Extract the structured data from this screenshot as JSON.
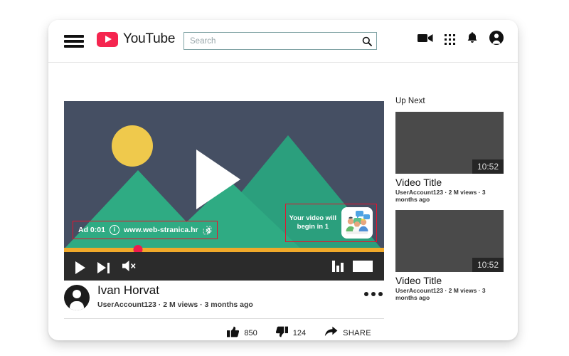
{
  "header": {
    "menu_icon": "hamburger-menu-icon",
    "brand": "YouTube",
    "logo_color": "#F5254F",
    "search": {
      "value": "",
      "placeholder": "Search",
      "icon": "search-icon"
    },
    "icons": [
      {
        "name": "video-camera-icon"
      },
      {
        "name": "apps-grid-icon"
      },
      {
        "name": "notifications-bell-icon"
      },
      {
        "name": "account-avatar-icon"
      }
    ]
  },
  "player": {
    "big_play_icon": "play-triangle-icon",
    "background_color": "#454f63",
    "mountain_color": "#2FAB83",
    "mountain_color_dark": "#2a9d7c",
    "sun_color": "#EFC94C",
    "ad": {
      "label": "Ad 0:01",
      "info_icon": "info-circle-icon",
      "url": "www.web-stranica.hr",
      "external_icon": "external-link-icon",
      "highlight_color": "#e8112d"
    },
    "countdown": {
      "line1": "Your video will",
      "line2": "begin in 1",
      "thumbnail_icon": "people-chat-thumbnail-icon",
      "highlight_color": "#e8112d"
    },
    "progress": {
      "percent": 23,
      "bar_color": "#f0a92a",
      "scrubber_color": "#ee1b4d"
    },
    "controls": {
      "play": "play-button-icon",
      "next": "next-video-icon",
      "volume": "volume-muted-icon",
      "quality": "quality-bars-icon",
      "fullscreen": "fullscreen-icon"
    }
  },
  "channel": {
    "name": "Ivan Horvat",
    "meta": "UserAccount123 · 2 M views · 3 months ago",
    "avatar_icon": "channel-avatar-icon",
    "more_icon": "more-options-icon"
  },
  "actions": {
    "like": {
      "icon": "thumbs-up-icon",
      "count": "850"
    },
    "dislike": {
      "icon": "thumbs-down-icon",
      "count": "124"
    },
    "share": {
      "icon": "share-arrow-icon",
      "label": "SHARE"
    }
  },
  "sidebar": {
    "title": "Up Next",
    "videos": [
      {
        "duration": "10:52",
        "title": "Video Title",
        "meta": "UserAccount123 · 2 M views · 3 months ago"
      },
      {
        "duration": "10:52",
        "title": "Video Title",
        "meta": "UserAccount123 · 2 M views · 3 months ago"
      }
    ]
  }
}
